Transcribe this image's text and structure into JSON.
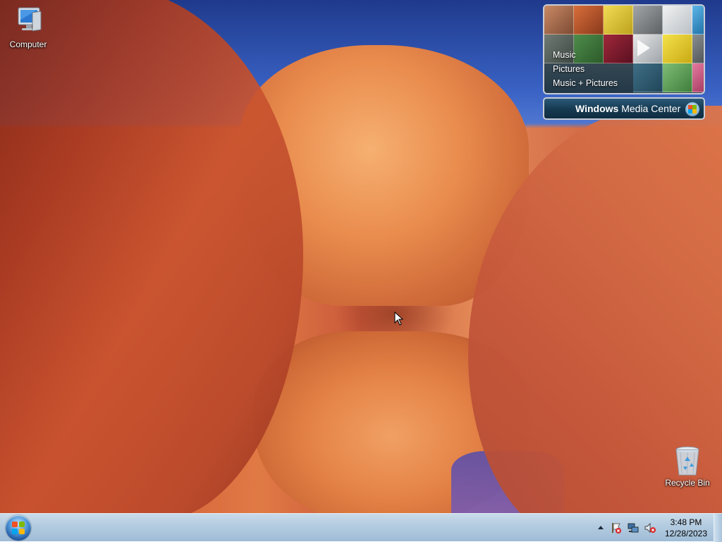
{
  "desktop": {
    "icons": [
      {
        "label": "Computer",
        "icon": "computer-icon"
      },
      {
        "label": "Recycle Bin",
        "icon": "recycle-bin-icon"
      }
    ]
  },
  "gadget": {
    "menu": [
      "Music",
      "Pictures",
      "Music + Pictures"
    ],
    "brand_bold": "Windows",
    "brand_rest": "Media Center",
    "icon": "windows-orb-icon"
  },
  "taskbar": {
    "start_icon": "windows-flag-icon",
    "tray_icons": [
      "show-hidden-icons-icon",
      "action-center-warning-icon",
      "network-icon",
      "volume-muted-icon"
    ],
    "time": "3:48 PM",
    "date": "12/28/2023"
  },
  "colors": {
    "taskbar_top": "#c9dbea",
    "taskbar_bottom": "#9fbcd6",
    "sky": "#3a63c5",
    "rock": "#d35d36"
  }
}
